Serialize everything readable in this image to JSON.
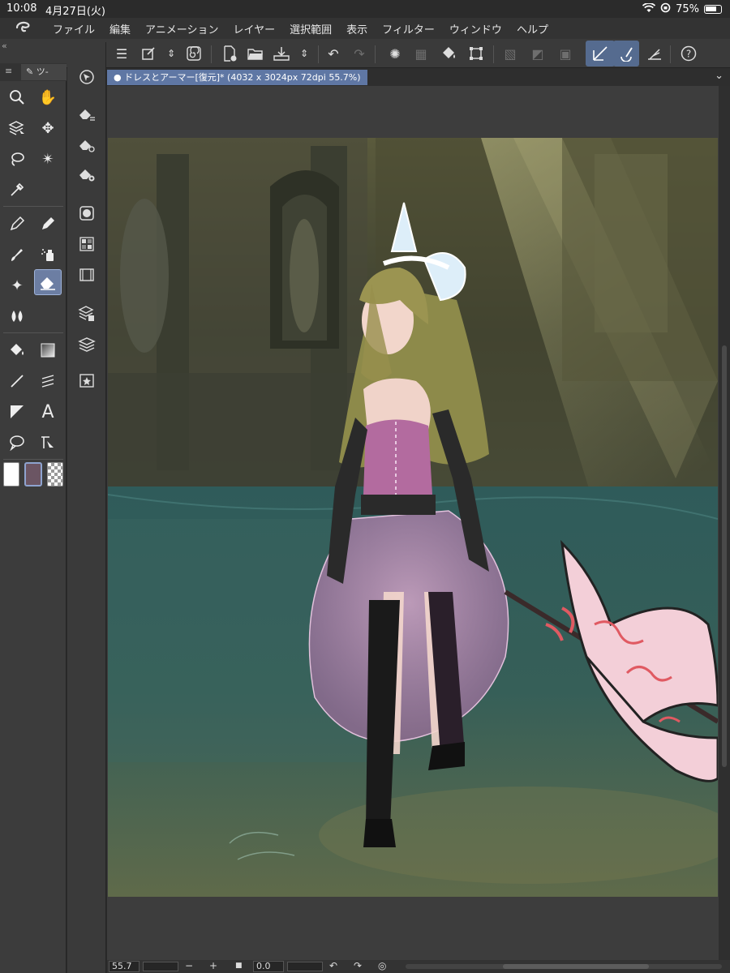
{
  "status": {
    "time": "10:08",
    "date": "4月27日(火)",
    "battery": "75%",
    "wifi_icon": "wifi-icon",
    "lock_icon": "orientation-lock-icon"
  },
  "menu": {
    "items": [
      "ファイル",
      "編集",
      "アニメーション",
      "レイヤー",
      "選択範囲",
      "表示",
      "フィルター",
      "ウィンドウ",
      "ヘルプ"
    ]
  },
  "toolpanel": {
    "tab_label": "ツ-",
    "colors": {
      "main": "#ffffff",
      "sub": "#6b5563",
      "transparent": "checker"
    }
  },
  "document": {
    "tab_title": "ドレスとアーマー[復元]* (4032 x 3024px 72dpi 55.7%)"
  },
  "bottombar": {
    "zoom": "55.7",
    "angle": "0.0"
  },
  "colors": {
    "accent": "#5f77a4",
    "selected_tool": "#6c7ea3"
  }
}
